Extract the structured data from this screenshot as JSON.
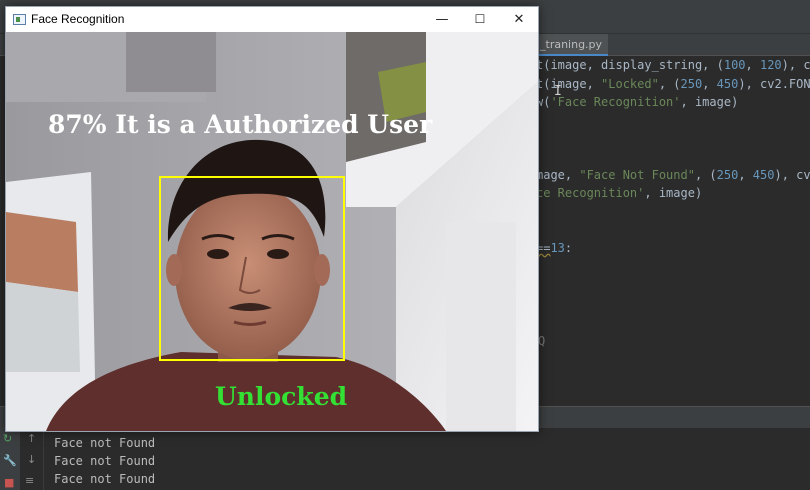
{
  "window": {
    "title": "Face Recognition",
    "controls": {
      "minimize": "—",
      "maximize": "☐",
      "close": "✕"
    }
  },
  "camera": {
    "overlay_text": "87% It is a Authorized User",
    "status_text": "Unlocked",
    "overlay_color": "#ffffff",
    "status_color": "#33e033",
    "face_box_color": "#ffff00"
  },
  "ide": {
    "file_tab": "_traning.py",
    "code_lines": [
      {
        "pre": "t(image, display_string, (",
        "n1": "100",
        "mid": ", ",
        "n2": "120",
        "post": "), cv2"
      },
      {
        "pre": "t(image, ",
        "s": "\"Locked\"",
        "mid2": ", (",
        "n1": "250",
        "mid": ", ",
        "n2": "450",
        "post": "), cv2.FONT_"
      },
      {
        "pre": "w(",
        "s": "'Face Recognition'",
        "post": ", image)"
      },
      {
        "pre": "mage, ",
        "s": "\"Face Not Found\"",
        "mid2": ", (",
        "n1": "250",
        "mid": ", ",
        "n2": "450",
        "post": "), cv2.F"
      },
      {
        "pre": "",
        "s": "ce Recognition'",
        "post": ", image)"
      },
      {
        "pre": "==",
        "n1": "13",
        "post": ":"
      },
      {
        "pre": "Q"
      }
    ],
    "output_lines": [
      "Face not Found",
      "Face not Found",
      "Face not Found"
    ]
  }
}
